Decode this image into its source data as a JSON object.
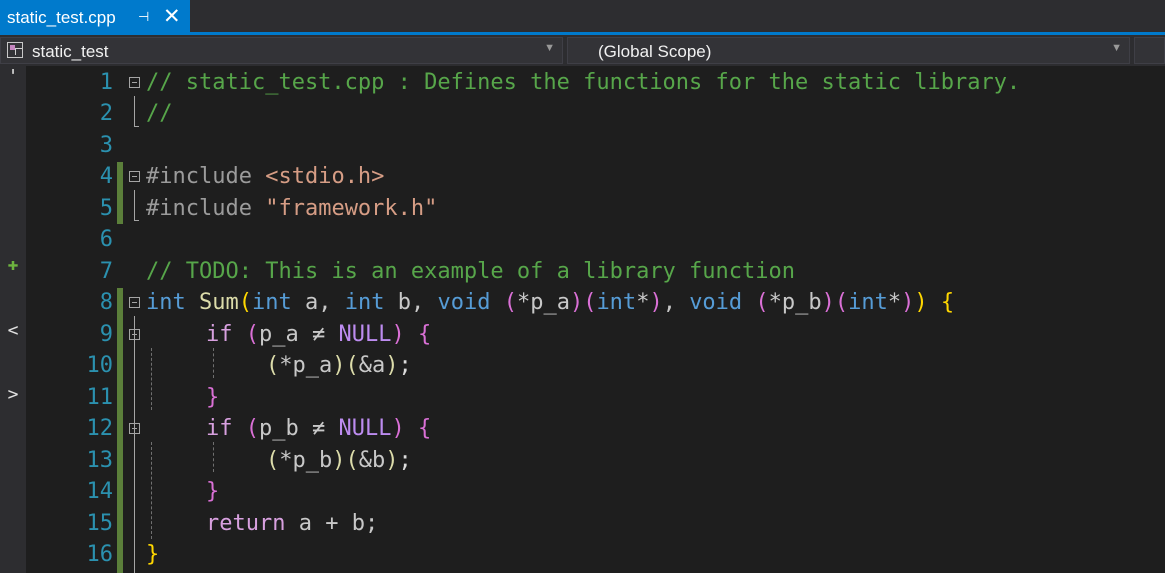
{
  "tab": {
    "title": "static_test.cpp",
    "pin_icon": "pin-icon",
    "close_icon": "close-icon",
    "close_glyph": "✕",
    "pin_glyph": "⊣"
  },
  "navbar": {
    "project": "static_test",
    "scope": "(Global Scope)"
  },
  "colors": {
    "accent": "#007acc",
    "editor_bg": "#1e1e1e",
    "line_number": "#2b91af",
    "comment": "#57a64a",
    "changed_marker": "#5b7f3a"
  },
  "editor": {
    "line_numbers": [
      "1",
      "2",
      "3",
      "4",
      "5",
      "6",
      "7",
      "8",
      "9",
      "10",
      "11",
      "12",
      "13",
      "14",
      "15",
      "16"
    ],
    "lines": {
      "l1": "// static_test.cpp : Defines the functions for the static library.",
      "l2": "//",
      "l4_dir": "#include ",
      "l4_file": "<stdio.h>",
      "l5_dir": "#include ",
      "l5_file": "\"framework.h\"",
      "l7": "// TODO: This is an example of a library function",
      "l8_int1": "int",
      "l8_sum": "Sum",
      "l8_p1": "(",
      "l8_int2": "int",
      "l8_a": " a, ",
      "l8_int3": "int",
      "l8_b": " b, ",
      "l8_void1": "void",
      "l8_s1": " ",
      "l8_p2": "(",
      "l8_pa": "*p_a",
      "l8_p3": ")",
      "l8_p4": "(",
      "l8_int4": "int",
      "l8_star1": "*",
      "l8_p5": ")",
      "l8_comma": ", ",
      "l8_void2": "void",
      "l8_s2": " ",
      "l8_p6": "(",
      "l8_pb": "*p_b",
      "l8_p7": ")",
      "l8_p8": "(",
      "l8_int5": "int",
      "l8_star2": "*",
      "l8_p9": ")",
      "l8_p10": ")",
      "l8_s3": " ",
      "l8_brace": "{",
      "l9_if": "if",
      "l9_s": " ",
      "l9_po": "(",
      "l9_var": "p_a",
      "l9_op": " ≠ ",
      "l9_null": "NULL",
      "l9_pc": ")",
      "l9_s2": " ",
      "l9_brace": "{",
      "l10_o1": "(",
      "l10_var": "*p_a",
      "l10_c1": ")",
      "l10_o2": "(",
      "l10_arg": "&a",
      "l10_c2": ")",
      "l10_semi": ";",
      "l11": "}",
      "l12_if": "if",
      "l12_s": " ",
      "l12_po": "(",
      "l12_var": "p_b",
      "l12_op": " ≠ ",
      "l12_null": "NULL",
      "l12_pc": ")",
      "l12_s2": " ",
      "l12_brace": "{",
      "l13_o1": "(",
      "l13_var": "*p_b",
      "l13_c1": ")",
      "l13_o2": "(",
      "l13_arg": "&b",
      "l13_c2": ")",
      "l13_semi": ";",
      "l14": "}",
      "l15_ret": "return",
      "l15_rest": " a + b;",
      "l16": "}"
    },
    "margin_glyphs": {
      "top": "'",
      "add": "✚",
      "collapse": "<",
      "expand": ">"
    }
  }
}
